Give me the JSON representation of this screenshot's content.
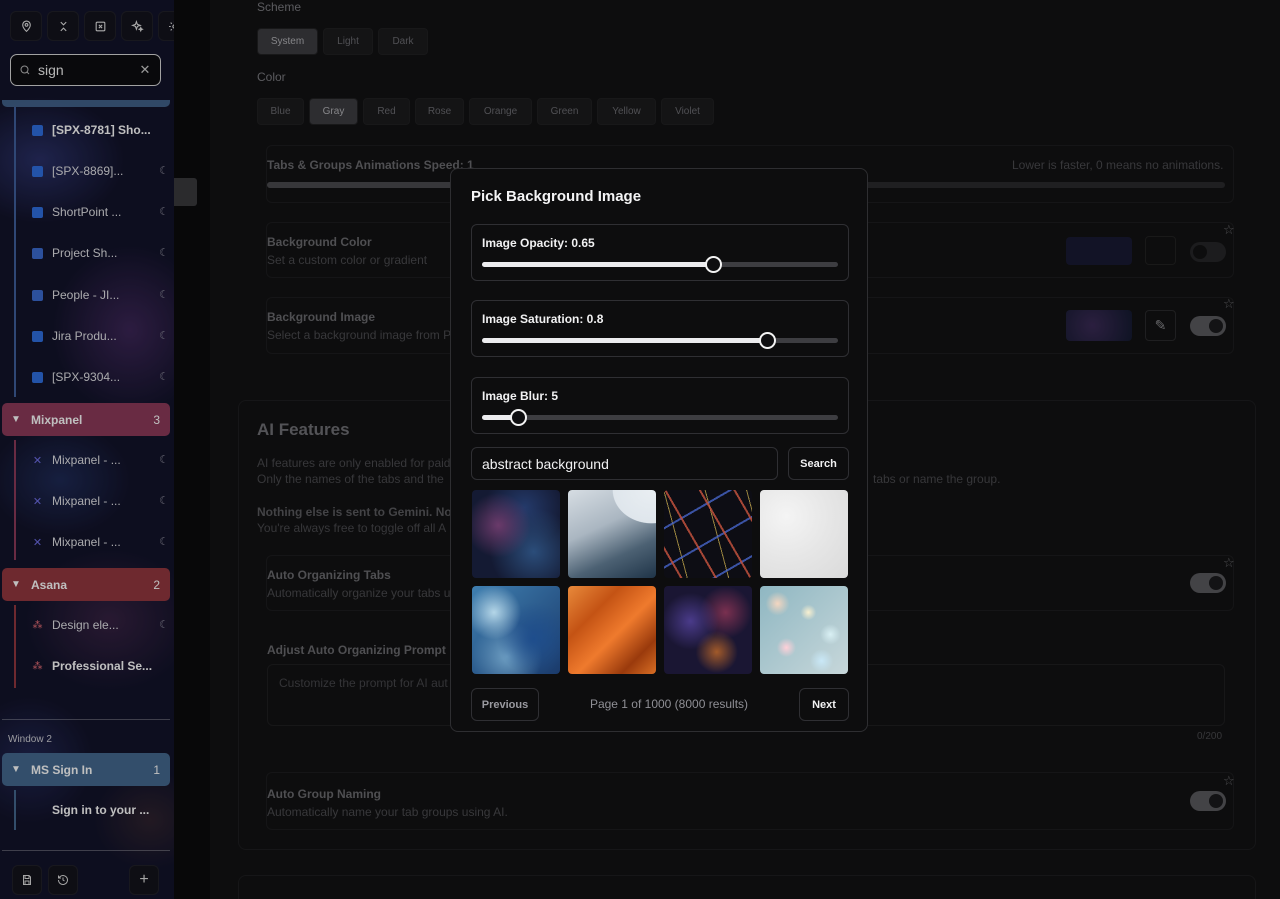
{
  "sidebar": {
    "search": {
      "value": "sign",
      "placeholder": ""
    },
    "tabs_top": [
      {
        "label": "[SPX-8781] Sho..."
      },
      {
        "label": "[SPX-8869]..."
      },
      {
        "label": "ShortPoint ..."
      },
      {
        "label": "Project Sh..."
      },
      {
        "label": "People - JI..."
      },
      {
        "label": "Jira Produ..."
      },
      {
        "label": "[SPX-9304..."
      }
    ],
    "groups": [
      {
        "name": "Mixpanel",
        "count": "3",
        "tabs": [
          {
            "label": "Mixpanel - ..."
          },
          {
            "label": "Mixpanel - ..."
          },
          {
            "label": "Mixpanel - ..."
          }
        ]
      },
      {
        "name": "Asana",
        "count": "2",
        "tabs": [
          {
            "label": "Design ele..."
          },
          {
            "label": "Professional Se..."
          }
        ]
      }
    ],
    "window_label": "Window 2",
    "window2_group": {
      "name": "MS Sign In",
      "count": "1",
      "tabs": [
        {
          "label": "Sign in to your ..."
        }
      ]
    }
  },
  "settings": {
    "scheme_label": "Scheme",
    "scheme_options": [
      "System",
      "Light",
      "Dark"
    ],
    "color_label": "Color",
    "color_options": [
      "Blue",
      "Gray",
      "Red",
      "Rose",
      "Orange",
      "Green",
      "Yellow",
      "Violet"
    ],
    "animation_title": "Tabs & Groups Animations Speed: 1",
    "animation_hint": "Lower is faster, 0 means no animations.",
    "bg_color_title": "Background Color",
    "bg_color_desc": "Set a custom color or gradient",
    "bg_image_title": "Background Image",
    "bg_image_desc": "Select a background image from P",
    "ai_title": "AI Features",
    "ai_line1": "AI features are only enabled for paid",
    "ai_line2": "Only the names of the tabs and the",
    "ai_line2_right": "tabs or name the group.",
    "ai_line3": "Nothing else is sent to Gemini. Noth",
    "ai_line4": "You're always free to toggle off all A",
    "auto_org_title": "Auto Organizing Tabs",
    "auto_org_desc": "Automatically organize your tabs u",
    "prompt_title": "Adjust Auto Organizing Prompt",
    "prompt_placeholder": "Customize the prompt for AI aut",
    "prompt_count": "0/200",
    "auto_name_title": "Auto Group Naming",
    "auto_name_desc": "Automatically name your tab groups using AI."
  },
  "modal": {
    "title": "Pick Background Image",
    "opacity": {
      "label": "Image Opacity: 0.65",
      "value": 0.65,
      "min": 0,
      "max": 1
    },
    "saturation": {
      "label": "Image Saturation: 0.8",
      "value": 0.8,
      "min": 0,
      "max": 1
    },
    "blur": {
      "label": "Image Blur: 5",
      "value": 5,
      "min": 0,
      "max": 50
    },
    "search_value": "abstract background",
    "search_button": "Search",
    "previous_button": "Previous",
    "next_button": "Next",
    "page_info": "Page 1 of 1000 (8000 results)"
  }
}
